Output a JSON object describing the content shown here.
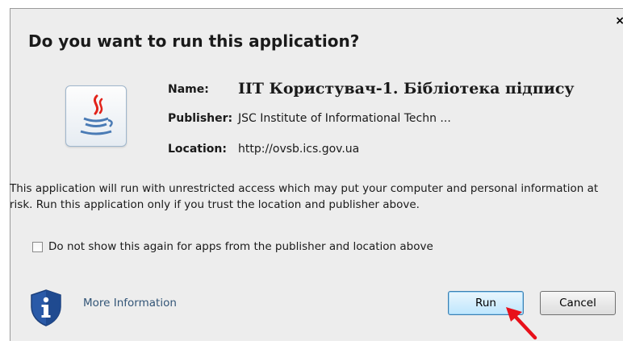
{
  "dialog": {
    "title": "Do you want to run this application?",
    "close_label": "×"
  },
  "app": {
    "icon": "java-cup-icon",
    "name_label": "Name:",
    "name_value": "ІІТ Користувач-1. Бібліотека підпису",
    "publisher_label": "Publisher:",
    "publisher_value": "JSC Institute of Informational Techn ...",
    "location_label": "Location:",
    "location_value": "http://ovsb.ics.gov.ua"
  },
  "warning": {
    "text": "This application will run with unrestricted access which may put your computer and personal information at risk. Run this application only if you trust the location and publisher above."
  },
  "checkbox": {
    "label": "Do not show this again for apps from the publisher and location above",
    "checked": false
  },
  "footer": {
    "info_icon": "shield-info-icon",
    "more_info_label": "More Information",
    "run_label": "Run",
    "cancel_label": "Cancel",
    "pointer_icon": "red-arrow-icon"
  },
  "colors": {
    "dialog_bg": "#ededed",
    "link": "#335577",
    "run_focus": "#3c7fb1",
    "arrow": "#e8101a",
    "shield": "#2a5aa8"
  }
}
